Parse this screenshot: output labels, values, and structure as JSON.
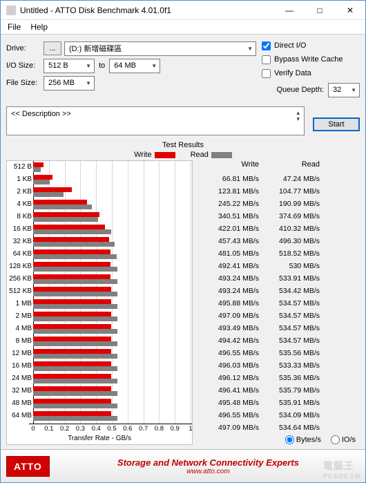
{
  "window": {
    "title": "Untitled - ATTO Disk Benchmark 4.01.0f1"
  },
  "menu": {
    "file": "File",
    "help": "Help"
  },
  "labels": {
    "drive": "Drive:",
    "iosize": "I/O Size:",
    "filesize": "File Size:",
    "to": "to",
    "direct_io": "Direct I/O",
    "bypass": "Bypass Write Cache",
    "verify": "Verify Data",
    "qdepth": "Queue Depth:",
    "start": "Start",
    "description": "<< Description >>",
    "test_results": "Test Results",
    "write": "Write",
    "read": "Read",
    "xlabel": "Transfer Rate - GB/s",
    "bytes_s": "Bytes/s",
    "io_s": "IO/s"
  },
  "values": {
    "drive_browse": "...",
    "drive": "(D:) 新增磁碟區",
    "io_from": "512 B",
    "io_to": "64 MB",
    "filesize": "256 MB",
    "qdepth": "32"
  },
  "footer": {
    "logo": "ATTO",
    "line1": "Storage and Network Connectivity Experts",
    "line2": "www.atto.com",
    "watermark1": "電腦王",
    "watermark2": "PCADV.TW"
  },
  "chart_data": {
    "type": "bar",
    "orientation": "horizontal",
    "xlabel": "Transfer Rate - GB/s",
    "xlim": [
      0,
      1
    ],
    "xticks": [
      0,
      0.1,
      0.2,
      0.3,
      0.4,
      0.5,
      0.6,
      0.7,
      0.8,
      0.9,
      1
    ],
    "unit": "MB/s",
    "series_names": [
      "Write",
      "Read"
    ],
    "categories": [
      "512 B",
      "1 KB",
      "2 KB",
      "4 KB",
      "8 KB",
      "16 KB",
      "32 KB",
      "64 KB",
      "128 KB",
      "256 KB",
      "512 KB",
      "1 MB",
      "2 MB",
      "4 MB",
      "8 MB",
      "12 MB",
      "16 MB",
      "24 MB",
      "32 MB",
      "48 MB",
      "64 MB"
    ],
    "write": [
      66.81,
      123.81,
      245.22,
      340.51,
      422.01,
      457.43,
      481.05,
      492.41,
      493.24,
      493.24,
      495.88,
      497.09,
      493.49,
      494.42,
      496.55,
      496.03,
      496.12,
      496.41,
      495.48,
      496.55,
      497.09
    ],
    "read": [
      47.24,
      104.77,
      190.99,
      374.69,
      410.32,
      496.3,
      518.52,
      530.0,
      533.91,
      534.42,
      534.57,
      534.57,
      534.57,
      534.57,
      535.56,
      533.33,
      535.36,
      535.79,
      535.91,
      534.09,
      534.64
    ],
    "write_labels": [
      "66.81 MB/s",
      "123.81 MB/s",
      "245.22 MB/s",
      "340.51 MB/s",
      "422.01 MB/s",
      "457.43 MB/s",
      "481.05 MB/s",
      "492.41 MB/s",
      "493.24 MB/s",
      "493.24 MB/s",
      "495.88 MB/s",
      "497.09 MB/s",
      "493.49 MB/s",
      "494.42 MB/s",
      "496.55 MB/s",
      "496.03 MB/s",
      "496.12 MB/s",
      "496.41 MB/s",
      "495.48 MB/s",
      "496.55 MB/s",
      "497.09 MB/s"
    ],
    "read_labels": [
      "47.24 MB/s",
      "104.77 MB/s",
      "190.99 MB/s",
      "374.69 MB/s",
      "410.32 MB/s",
      "496.30 MB/s",
      "518.52 MB/s",
      "530 MB/s",
      "533.91 MB/s",
      "534.42 MB/s",
      "534.57 MB/s",
      "534.57 MB/s",
      "534.57 MB/s",
      "534.57 MB/s",
      "535.56 MB/s",
      "533.33 MB/s",
      "535.36 MB/s",
      "535.79 MB/s",
      "535.91 MB/s",
      "534.09 MB/s",
      "534.64 MB/s"
    ]
  }
}
